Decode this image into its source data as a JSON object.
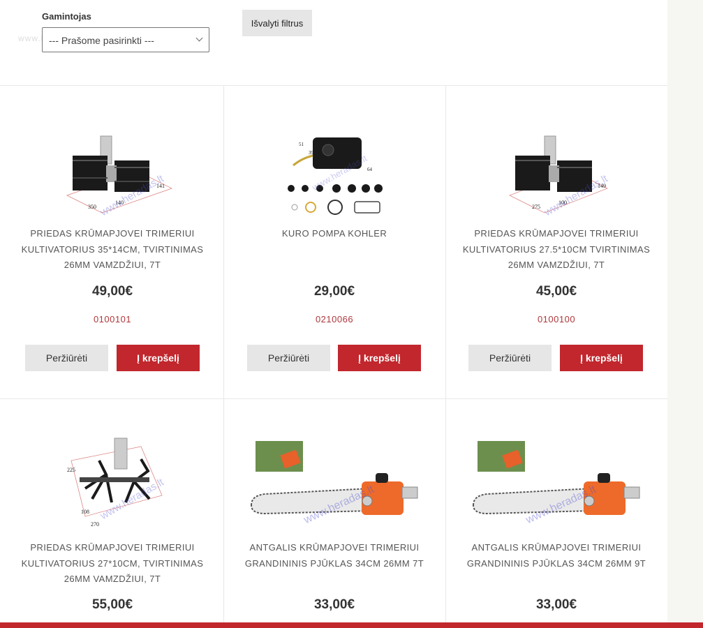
{
  "filters": {
    "manufacturer_label": "Gamintojas",
    "manufacturer_selected": "--- Prašome pasirinkti ---",
    "clear_label": "Išvalyti filtrus"
  },
  "watermark_text": "www.heradas.lt",
  "products": [
    {
      "name": "PRIEDAS KRŪMAPJOVEI TRIMERIUI KULTIVATORIUS 35*14CM, TVIRTINIMAS 26MM VAMZDŽIUI, 7T",
      "price": "49,00€",
      "code": "0100101",
      "view_label": "Peržiūrėti",
      "cart_label": "Į krepšelį",
      "img_labels": [
        "141",
        "350",
        "140"
      ]
    },
    {
      "name": "KURO POMPA KOHLER",
      "price": "29,00€",
      "code": "0210066",
      "view_label": "Peržiūrėti",
      "cart_label": "Į krepšelį",
      "img_labels": [
        "51",
        "39",
        "64"
      ]
    },
    {
      "name": "PRIEDAS KRŪMAPJOVEI TRIMERIUI KULTIVATORIUS 27.5*10CM TVIRTINIMAS 26MM VAMZDŽIUI, 7T",
      "price": "45,00€",
      "code": "0100100",
      "view_label": "Peržiūrėti",
      "cart_label": "Į krepšelį",
      "img_labels": [
        "149",
        "275",
        "100"
      ]
    },
    {
      "name": "PRIEDAS KRŪMAPJOVEI TRIMERIUI KULTIVATORIUS 27*10CM, TVIRTINIMAS 26MM VAMZDŽIUI, 7T",
      "price": "55,00€",
      "img_labels": [
        "225",
        "108",
        "270"
      ]
    },
    {
      "name": "ANTGALIS KRŪMAPJOVEI TRIMERIUI GRANDININIS PJŪKLAS 34CM 26MM 7T",
      "price": "33,00€"
    },
    {
      "name": "ANTGALIS KRŪMAPJOVEI TRIMERIUI GRANDININIS PJŪKLAS 34CM 26MM 9T",
      "price": "33,00€"
    }
  ],
  "colors": {
    "accent": "#c1272d",
    "code": "#b0373b",
    "button_gray": "#e6e6e6"
  }
}
